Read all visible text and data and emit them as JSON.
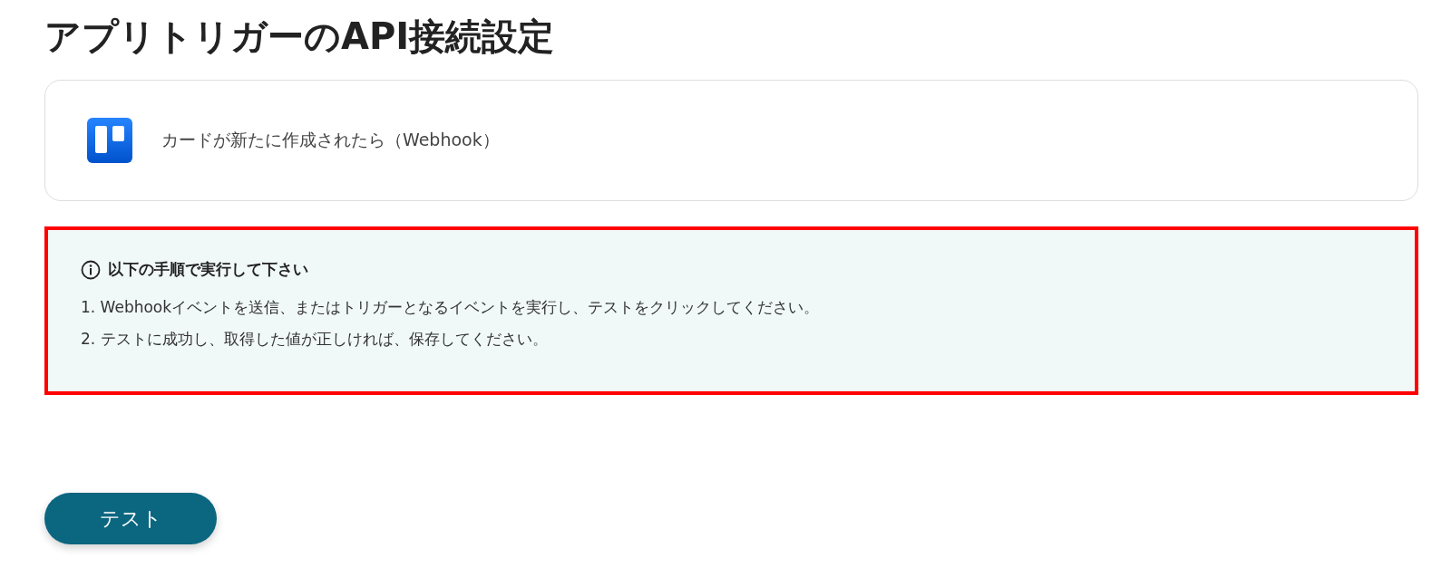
{
  "title": "アプリトリガーのAPI接続設定",
  "trigger": {
    "label": "カードが新たに作成されたら（Webhook）"
  },
  "instructions": {
    "highlighted": true,
    "heading": "以下の手順で実行して下さい",
    "steps": [
      "1. Webhookイベントを送信、またはトリガーとなるイベントを実行し、テストをクリックしてください。",
      "2. テストに成功し、取得した値が正しければ、保存してください。"
    ]
  },
  "buttons": [
    {
      "label": "テスト"
    }
  ]
}
